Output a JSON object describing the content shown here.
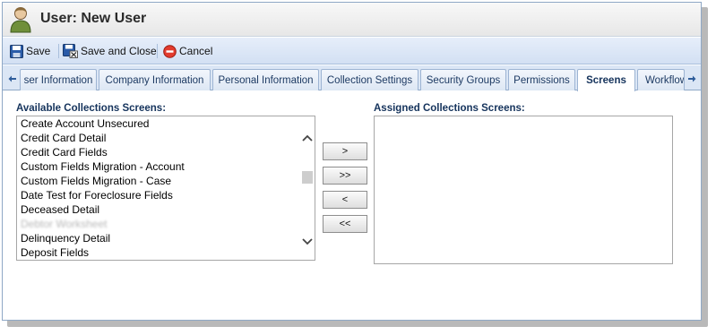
{
  "window": {
    "title": "User: New User"
  },
  "toolbar": {
    "save": "Save",
    "save_and_close": "Save and Close",
    "cancel": "Cancel"
  },
  "tabs": [
    {
      "label": "ser Information",
      "active": false
    },
    {
      "label": "Company Information",
      "active": false
    },
    {
      "label": "Personal Information",
      "active": false
    },
    {
      "label": "Collection Settings",
      "active": false
    },
    {
      "label": "Security Groups",
      "active": false
    },
    {
      "label": "Permissions",
      "active": false
    },
    {
      "label": "Screens",
      "active": true
    },
    {
      "label": "Workflow",
      "active": false
    }
  ],
  "available": {
    "label": "Available Collections Screens:",
    "items": [
      "Create Account Unsecured",
      "Credit Card Detail",
      "Credit Card Fields",
      "Custom Fields Migration - Account",
      "Custom Fields Migration - Case",
      "Date Test for Foreclosure Fields",
      "Deceased Detail",
      "Debtor Worksheet",
      "Delinquency Detail",
      "Deposit Fields"
    ]
  },
  "assigned": {
    "label": "Assigned Collections Screens:",
    "items": []
  },
  "buttons": {
    "add": ">",
    "add_all": ">>",
    "remove": "<",
    "remove_all": "<<"
  },
  "colors": {
    "accent": "#15335c",
    "toolbar": "#d3e0f3",
    "tab_border": "#9db4d3"
  },
  "icons": {
    "user": "user-icon",
    "save": "floppy-disk-icon",
    "save_and_close": "floppy-disk-close-icon",
    "cancel": "cancel-circle-icon",
    "tab_left": "arrow-left-icon",
    "tab_right": "arrow-right-icon",
    "scroll_up": "chevron-up-icon",
    "scroll_down": "chevron-down-icon"
  }
}
